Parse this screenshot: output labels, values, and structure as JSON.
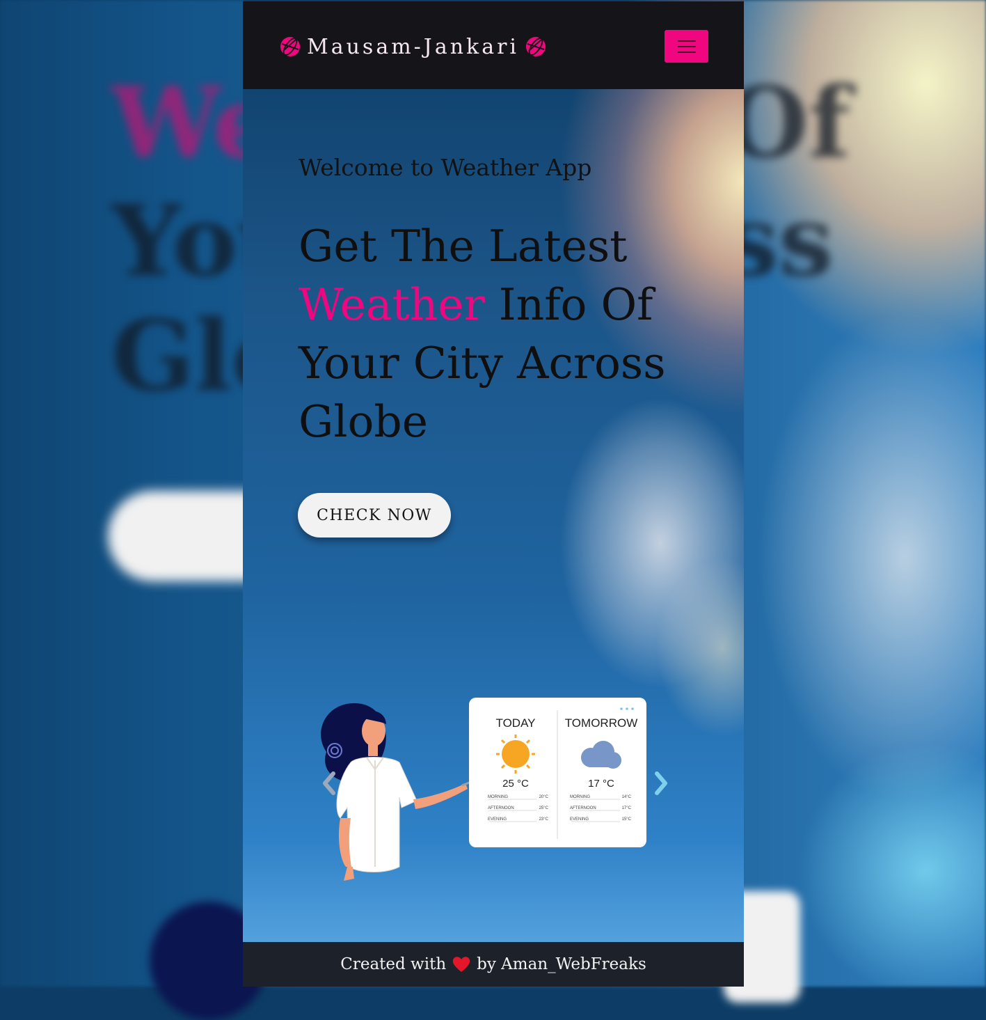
{
  "brand": {
    "name": "Mausam-Jankari",
    "accent_color": "#f0077f",
    "icon": "globe-icon"
  },
  "navbar": {
    "toggler_icon": "hamburger-menu-icon"
  },
  "hero": {
    "welcome": "Welcome to Weather App",
    "headline_line1": "Get The Latest",
    "headline_accent": "Weather",
    "headline_rest2": "Info Of",
    "headline_line3": "Your City Across",
    "headline_line4": "Globe",
    "cta_label": "CHECK NOW"
  },
  "carousel": {
    "prev_icon": "chevron-left-icon",
    "next_icon": "chevron-right-icon",
    "forecast_card": {
      "today": {
        "title": "TODAY",
        "temp": "25 °C",
        "icon": "sun-icon",
        "rows": [
          [
            "MORNING",
            "20°C"
          ],
          [
            "AFTERNOON",
            "25°C"
          ],
          [
            "EVENING",
            "23°C"
          ]
        ]
      },
      "tomorrow": {
        "title": "TOMORROW",
        "temp": "17 °C",
        "icon": "cloud-icon",
        "rows": [
          [
            "MORNING",
            "14°C"
          ],
          [
            "AFTERNOON",
            "17°C"
          ],
          [
            "EVENING",
            "15°C"
          ]
        ]
      }
    }
  },
  "footer": {
    "prefix": "Created with",
    "icon": "heart-icon",
    "suffix": "by Aman_WebFreaks"
  },
  "background_words": [
    "We",
    "Of",
    "You",
    "ss",
    "Glo"
  ]
}
